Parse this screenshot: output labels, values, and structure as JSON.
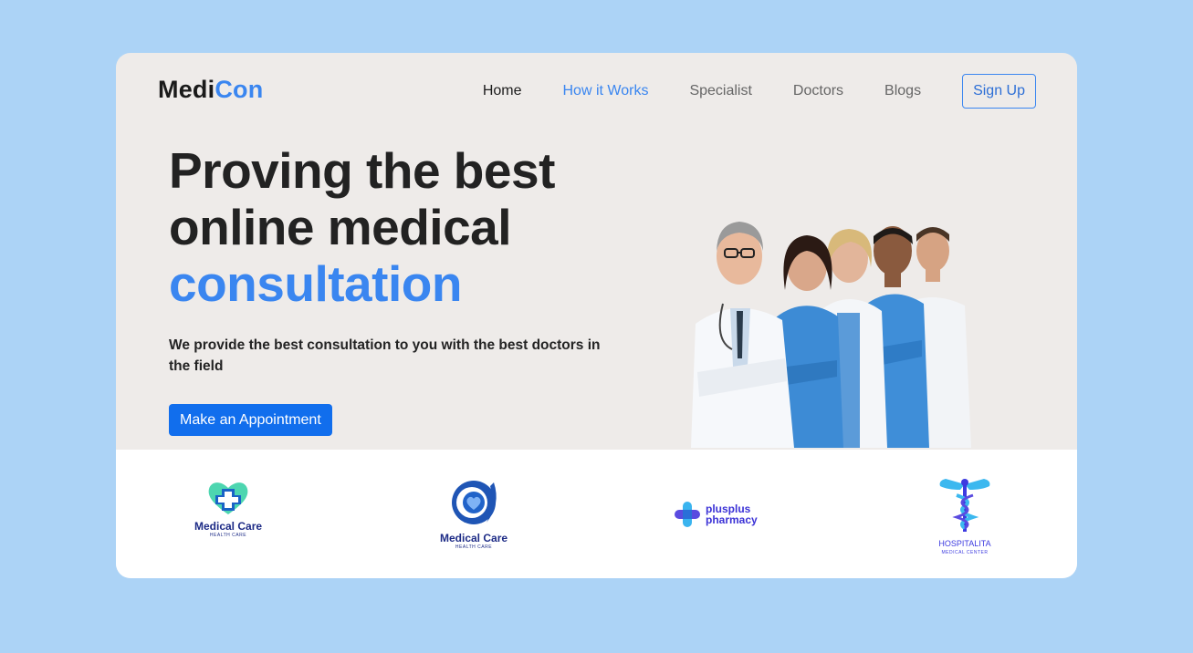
{
  "brand": {
    "part1": "Medi",
    "part2": "Con"
  },
  "nav": [
    {
      "label": "Home",
      "active": false
    },
    {
      "label": "How it Works",
      "active": true
    },
    {
      "label": "Specialist",
      "active": false
    },
    {
      "label": "Doctors",
      "active": false
    },
    {
      "label": "Blogs",
      "active": false
    }
  ],
  "signup_label": "Sign Up",
  "hero": {
    "line1": "Proving the best",
    "line2": "online medical",
    "line3": "consultation",
    "subtitle": "We provide the best consultation to you with the best doctors in the field",
    "cta_label": "Make an Appointment"
  },
  "partners": [
    {
      "name": "Medical Care",
      "sub": "HEALTH CARE"
    },
    {
      "name": "Medical Care",
      "sub": "HEALTH CARE"
    },
    {
      "name": "plusplus pharmacy"
    },
    {
      "name": "HOSPITALITA",
      "sub": "MEDICAL CENTER"
    }
  ],
  "colors": {
    "accent": "#3a86f0",
    "button": "#116eed",
    "page_bg": "#acd3f6",
    "card_bg": "#eeebe9"
  }
}
